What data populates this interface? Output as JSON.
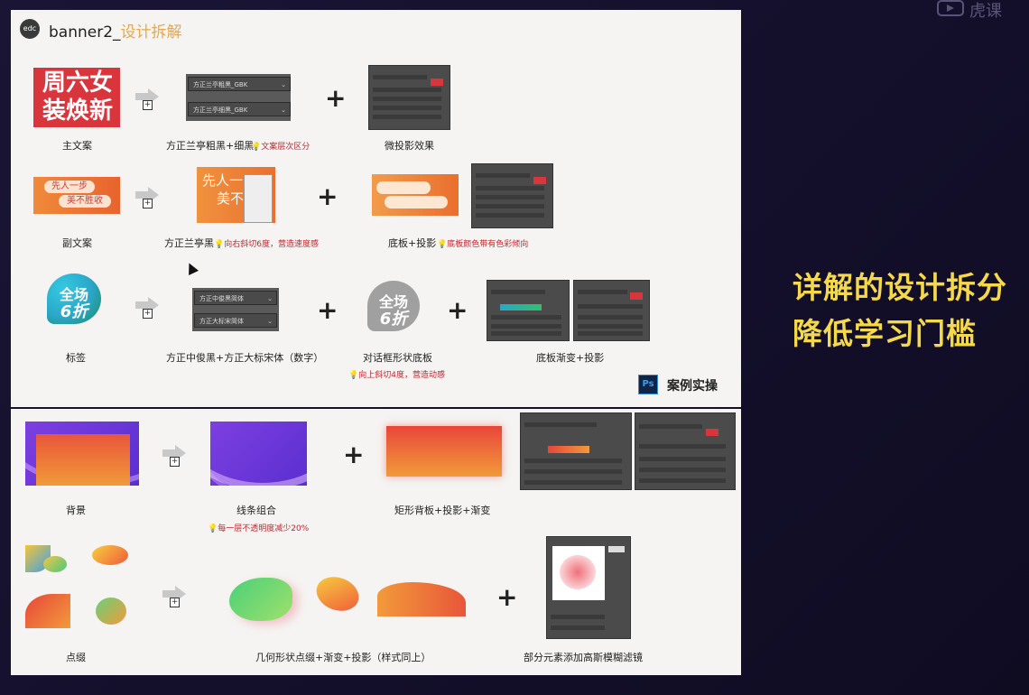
{
  "header": {
    "logo": "edc",
    "title_main": "banner2_",
    "title_hl": "设计拆解"
  },
  "rows": {
    "r1": {
      "label1": "主文案",
      "label2": "方正兰亭粗黑+细黑",
      "note2": "文案层次区分",
      "label3": "微投影效果",
      "poster_line1": "周六女",
      "poster_line2": "装焕新",
      "font1": "方正兰亭粗黑_GBK",
      "font2": "方正兰亭细黑_GBK"
    },
    "r2": {
      "label1": "副文案",
      "label2": "方正兰亭黑",
      "note2": "向右斜切6度，营造速度感",
      "label3": "底板+投影",
      "note3": "底板颜色带有色彩倾向",
      "chip1": "先人一步",
      "chip2": "美不胜收",
      "sample1": "先人一",
      "sample2": "美不"
    },
    "r3": {
      "label1": "标签",
      "label2": "方正中俊黑+方正大标宋体（数字）",
      "label3": "对话框形状底板",
      "note3": "向上斜切4度，营造动感",
      "label4": "底板渐变+投影",
      "tag_line1": "全场",
      "tag_line2": "6折",
      "font1": "方正中俊黑简体",
      "font2": "方正大标宋简体"
    },
    "r4": {
      "label1": "背景",
      "label2": "线条组合",
      "note2": "每一层不透明度减少20%",
      "label3": "矩形背板+投影+渐变"
    },
    "r5": {
      "label1": "点缀",
      "label2": "几何形状点缀+渐变+投影（样式同上）",
      "label3": "部分元素添加高斯模糊滤镜"
    }
  },
  "ps": {
    "badge": "Ps",
    "label": "案例实操"
  },
  "side": {
    "line1": "详解的设计拆分",
    "line2": "降低学习门槛"
  },
  "watermark": "虎课",
  "colors": {
    "orange": "#ef7a2e",
    "red": "#d8363c",
    "purple": "#6a3fd8",
    "yellow": "#f5d94a"
  }
}
